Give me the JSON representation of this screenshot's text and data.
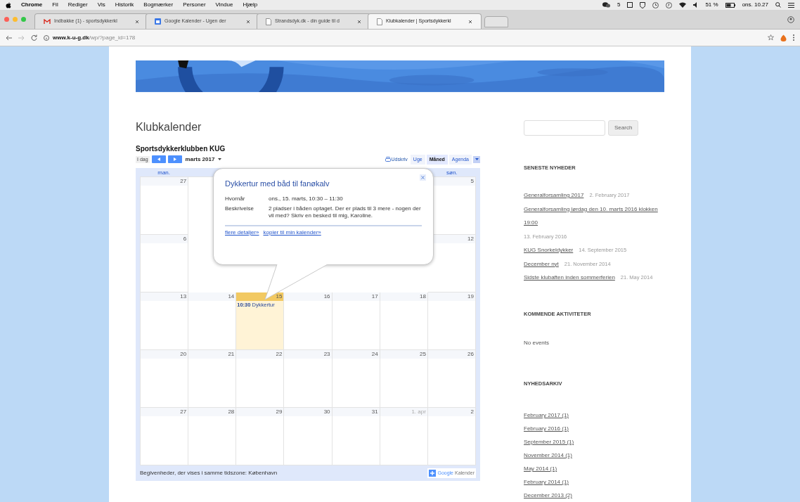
{
  "menubar": {
    "app": "Chrome",
    "items": [
      "Fil",
      "Rediger",
      "Vis",
      "Historik",
      "Bogmærker",
      "Personer",
      "Vindue",
      "Hjælp"
    ],
    "notifications": "5",
    "battery": "51 %",
    "clock": "ons. 10.27"
  },
  "tabs": [
    {
      "kind": "mail",
      "title": "Indbakke (1) - sportsdykkerkl",
      "selected": false
    },
    {
      "kind": "calendar",
      "title": "Google Kalender - Ugen der",
      "selected": false
    },
    {
      "kind": "page",
      "title": "Strandsdyk.dk - din guide til d",
      "selected": false
    },
    {
      "kind": "page",
      "title": "Klubkalender | Sportsdykkerkl",
      "selected": true
    }
  ],
  "address": {
    "host": "www.k-u-g.dk",
    "path": "/wp/?page_id=178"
  },
  "page": {
    "title": "Klubkalender"
  },
  "calendar": {
    "name": "Sportsdykkerklubben KUG",
    "today_button": "I dag",
    "month": "marts 2017",
    "print": "Udskriv",
    "views": [
      {
        "label": "Uge",
        "selected": false
      },
      {
        "label": "Måned",
        "selected": true
      },
      {
        "label": "Agenda",
        "selected": false
      }
    ],
    "day_headers": {
      "first": "man.",
      "last": "søn."
    },
    "weeks": [
      {
        "kind": "edges",
        "first": {
          "day": "27"
        },
        "last": {
          "day": "5"
        }
      },
      {
        "kind": "edges",
        "first": {
          "day": "6"
        },
        "last": {
          "day": "12"
        }
      },
      {
        "kind": "full",
        "days": [
          {
            "day": "13"
          },
          {
            "day": "14"
          },
          {
            "day": "15",
            "today": true,
            "events": [
              {
                "time": "10:30",
                "title": "Dykkertur"
              }
            ]
          },
          {
            "day": "16"
          },
          {
            "day": "17"
          },
          {
            "day": "18"
          },
          {
            "day": "19"
          }
        ]
      },
      {
        "kind": "full",
        "days": [
          {
            "day": "20"
          },
          {
            "day": "21"
          },
          {
            "day": "22"
          },
          {
            "day": "23"
          },
          {
            "day": "24"
          },
          {
            "day": "25"
          },
          {
            "day": "26"
          }
        ]
      },
      {
        "kind": "full",
        "days": [
          {
            "day": "27"
          },
          {
            "day": "28"
          },
          {
            "day": "29"
          },
          {
            "day": "30"
          },
          {
            "day": "31"
          },
          {
            "day": "1. apr",
            "other_month": true
          },
          {
            "day": "2"
          }
        ]
      }
    ],
    "timezone_note": "Begivenheder, der vises i samme tidszone: København",
    "brand_google": "Google",
    "brand_product": "Kalender"
  },
  "popup": {
    "title": "Dykkertur med båd til fanøkalv",
    "fields": [
      {
        "label": "Hvornår",
        "value": "ons., 15. marts, 10:30 – 11:30"
      },
      {
        "label": "Beskrivelse",
        "value": "2 pladser i båden optaget. Der er plads til 3 mere - nogen der vil med? Skriv en besked til mig, Karoline."
      }
    ],
    "links": [
      "flere detaljer»",
      "kopier til min kalender»"
    ]
  },
  "sidebar": {
    "search_button": "Search",
    "news_heading": "SENESTE NYHEDER",
    "news": [
      {
        "title": "Generalforsamling 2017",
        "date": "2. February 2017"
      },
      {
        "title": "Generalforsamling lørdag den 10. marts 2016 klokken 19:00",
        "date": "13. February 2016"
      },
      {
        "title": "KUG Snorkeldykker",
        "date": "14. September 2015"
      },
      {
        "title": "December nyt",
        "date": "21. November 2014"
      },
      {
        "title": "Sidste klubaften inden sommerferien",
        "date": "21. May 2014"
      }
    ],
    "events_heading": "KOMMENDE AKTIVITETER",
    "events_empty": "No events",
    "archive_heading": "NYHEDSARKIV",
    "archive": [
      "February 2017 (1)",
      "February 2016 (1)",
      "September 2015 (1)",
      "November 2014 (1)",
      "May 2014 (1)",
      "February 2014 (1)",
      "December 2013 (2)"
    ]
  }
}
